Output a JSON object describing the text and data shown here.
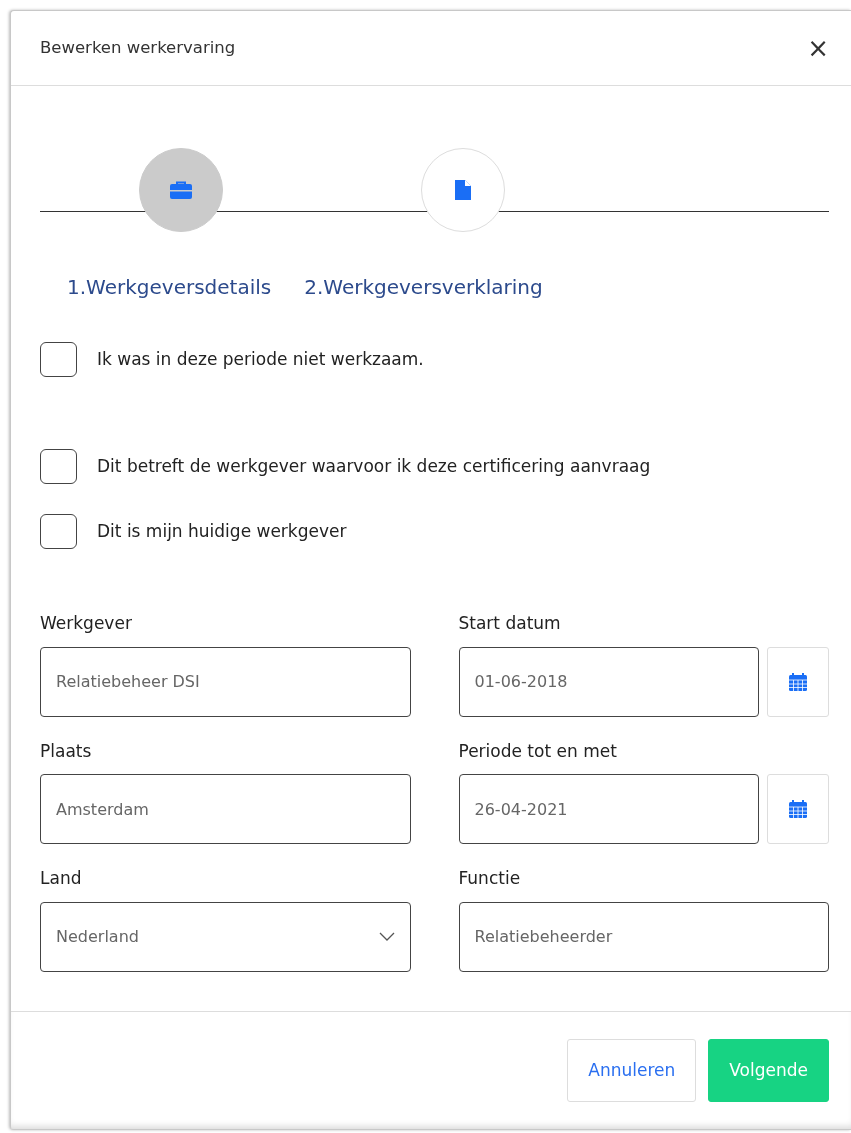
{
  "modal": {
    "title": "Bewerken werkervaring",
    "close": "×"
  },
  "steps": [
    {
      "label": "1.Werkgeversdetails",
      "selected": true,
      "kind": "briefcase"
    },
    {
      "label": "2.Werkgeversverklaring",
      "selected": false,
      "kind": "document"
    }
  ],
  "checkboxes": [
    {
      "label": "Ik was in deze periode niet werkzaam.",
      "checked": false
    },
    {
      "label": "Dit betreft de werkgever waarvoor ik deze certificering aanvraag",
      "checked": false
    },
    {
      "label": "Dit is mijn huidige werkgever",
      "checked": false
    }
  ],
  "fields": [
    {
      "label": "Werkgever",
      "value": "Relatiebeheer DSI",
      "kind": "text"
    },
    {
      "label": "Start datum",
      "value": "01-06-2018",
      "kind": "date"
    },
    {
      "label": "Plaats",
      "value": "Amsterdam",
      "kind": "text"
    },
    {
      "label": "Periode tot en met",
      "value": "26-04-2021",
      "kind": "date"
    },
    {
      "label": "Land",
      "value": "Nederland",
      "kind": "select"
    },
    {
      "label": "Functie",
      "value": "Relatiebeheerder",
      "kind": "text"
    }
  ],
  "buttons": [
    {
      "label": "Annuleren",
      "kind": "secondary"
    },
    {
      "label": "Volgende",
      "kind": "primary"
    }
  ]
}
